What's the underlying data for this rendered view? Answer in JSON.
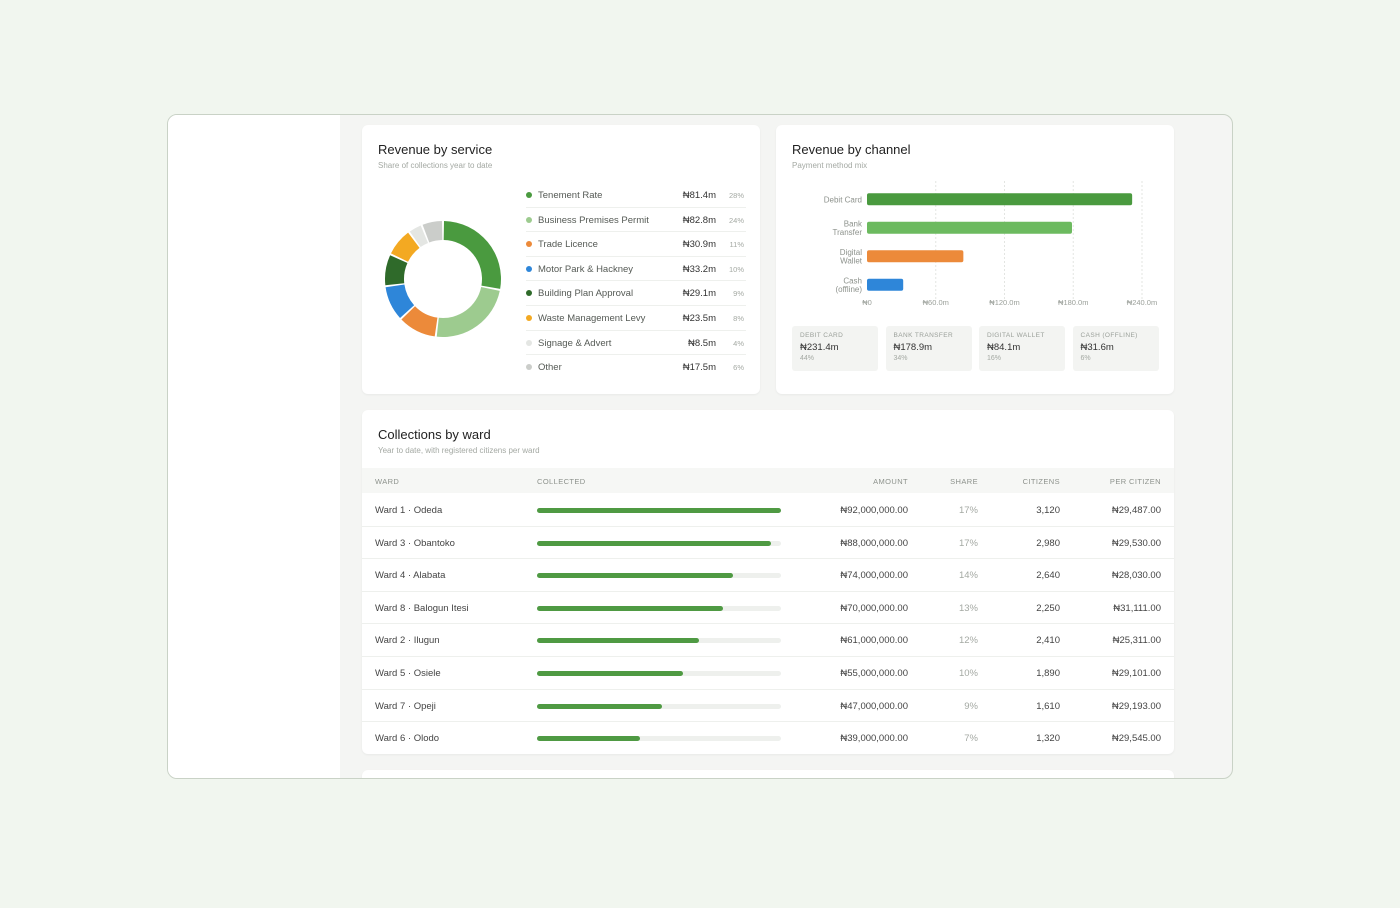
{
  "service": {
    "title": "Revenue by service",
    "subtitle": "Share of collections year to date",
    "items": [
      {
        "name": "Tenement Rate",
        "amount": "₦81.4m",
        "pct": "28%",
        "value": 28,
        "color": "#4a9a3f"
      },
      {
        "name": "Business Premises Permit",
        "amount": "₦82.8m",
        "pct": "24%",
        "value": 24,
        "color": "#9dcb8f"
      },
      {
        "name": "Trade Licence",
        "amount": "₦30.9m",
        "pct": "11%",
        "value": 11,
        "color": "#ec8a3a"
      },
      {
        "name": "Motor Park & Hackney",
        "amount": "₦33.2m",
        "pct": "10%",
        "value": 10,
        "color": "#2e86d9"
      },
      {
        "name": "Building Plan Approval",
        "amount": "₦29.1m",
        "pct": "9%",
        "value": 9,
        "color": "#2f6a2a"
      },
      {
        "name": "Waste Management Levy",
        "amount": "₦23.5m",
        "pct": "8%",
        "value": 8,
        "color": "#f3a922"
      },
      {
        "name": "Signage & Advert",
        "amount": "₦8.5m",
        "pct": "4%",
        "value": 4,
        "color": "#e4e6e3"
      },
      {
        "name": "Other",
        "amount": "₦17.5m",
        "pct": "6%",
        "value": 6,
        "color": "#cbcdca"
      }
    ]
  },
  "channel": {
    "title": "Revenue by channel",
    "subtitle": "Payment method mix",
    "tiles": [
      {
        "label": "DEBIT CARD",
        "value": "₦231.4m",
        "pct": "44%"
      },
      {
        "label": "BANK TRANSFER",
        "value": "₦178.9m",
        "pct": "34%"
      },
      {
        "label": "DIGITAL WALLET",
        "value": "₦84.1m",
        "pct": "16%"
      },
      {
        "label": "CASH (OFFLINE)",
        "value": "₦31.6m",
        "pct": "6%"
      }
    ]
  },
  "chart_data": {
    "type": "bar",
    "orientation": "horizontal",
    "categories": [
      [
        "Debit Card"
      ],
      [
        "Bank",
        "Transfer"
      ],
      [
        "Digital",
        "Wallet"
      ],
      [
        "Cash",
        "(offline)"
      ]
    ],
    "values": [
      231.4,
      178.9,
      84.1,
      31.6
    ],
    "colors": [
      "#4a9a3f",
      "#6cba5f",
      "#ec8a3a",
      "#2e86d9"
    ],
    "xlim": [
      0,
      240
    ],
    "xticks": [
      0,
      60,
      120,
      180,
      240
    ],
    "xtick_labels": [
      "₦0",
      "₦60.0m",
      "₦120.0m",
      "₦180.0m",
      "₦240.0m"
    ],
    "grid": "vertical-dashed"
  },
  "wards": {
    "title": "Collections by ward",
    "subtitle": "Year to date, with registered citizens per ward",
    "headers": {
      "ward": "WARD",
      "collected": "COLLECTED",
      "amount": "AMOUNT",
      "share": "SHARE",
      "citizens": "CITIZENS",
      "per": "PER CITIZEN"
    },
    "rows": [
      {
        "ward": "Ward 1 · Odeda",
        "fraction": 1.0,
        "amount": "₦92,000,000.00",
        "share": "17%",
        "citizens": "3,120",
        "per": "₦29,487.00"
      },
      {
        "ward": "Ward 3 · Obantoko",
        "fraction": 0.957,
        "amount": "₦88,000,000.00",
        "share": "17%",
        "citizens": "2,980",
        "per": "₦29,530.00"
      },
      {
        "ward": "Ward 4 · Alabata",
        "fraction": 0.804,
        "amount": "₦74,000,000.00",
        "share": "14%",
        "citizens": "2,640",
        "per": "₦28,030.00"
      },
      {
        "ward": "Ward 8 · Balogun Itesi",
        "fraction": 0.761,
        "amount": "₦70,000,000.00",
        "share": "13%",
        "citizens": "2,250",
        "per": "₦31,111.00"
      },
      {
        "ward": "Ward 2 · Ilugun",
        "fraction": 0.663,
        "amount": "₦61,000,000.00",
        "share": "12%",
        "citizens": "2,410",
        "per": "₦25,311.00"
      },
      {
        "ward": "Ward 5 · Osiele",
        "fraction": 0.598,
        "amount": "₦55,000,000.00",
        "share": "10%",
        "citizens": "1,890",
        "per": "₦29,101.00"
      },
      {
        "ward": "Ward 7 · Opeji",
        "fraction": 0.511,
        "amount": "₦47,000,000.00",
        "share": "9%",
        "citizens": "1,610",
        "per": "₦29,193.00"
      },
      {
        "ward": "Ward 6 · Olodo",
        "fraction": 0.424,
        "amount": "₦39,000,000.00",
        "share": "7%",
        "citizens": "1,320",
        "per": "₦29,545.00"
      }
    ]
  }
}
